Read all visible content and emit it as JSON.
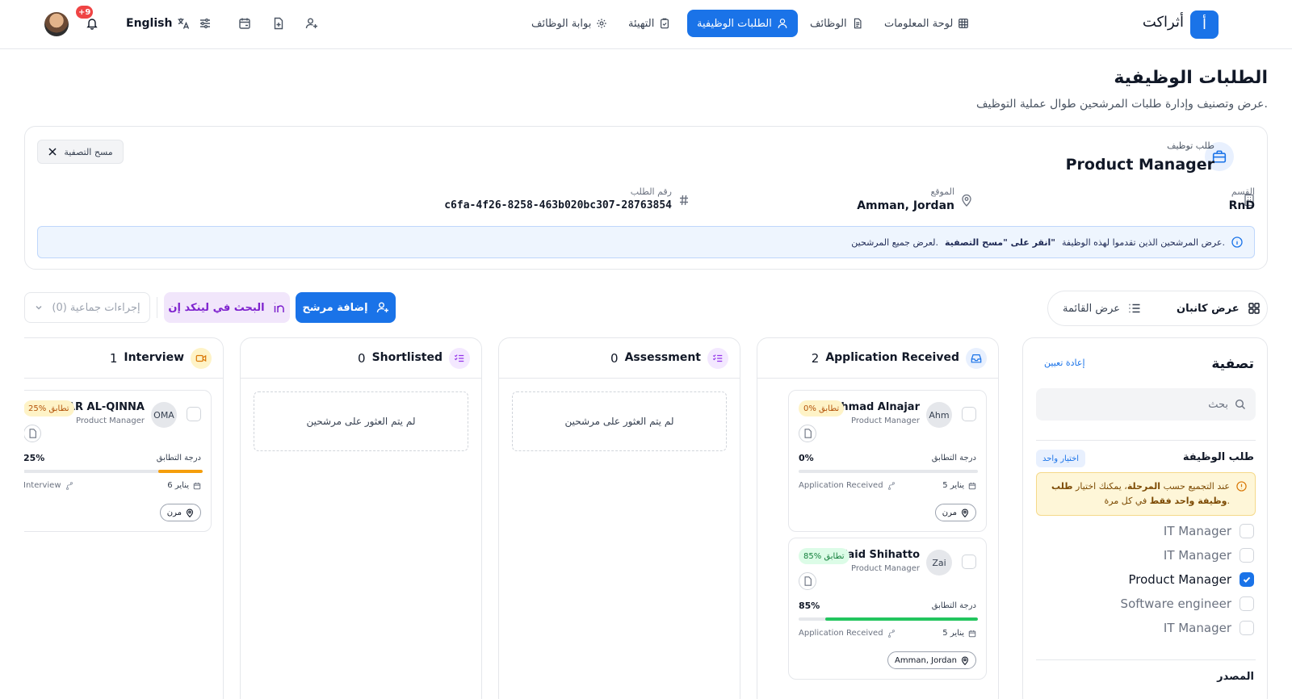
{
  "app": {
    "logo_letter": "أ",
    "name": "أثراكت"
  },
  "nav": [
    {
      "label": "لوحة المعلومات",
      "icon": "grid-icon"
    },
    {
      "label": "الوظائف",
      "icon": "document-icon"
    },
    {
      "label": "الطلبات الوظيفية",
      "icon": "user-icon",
      "active": true
    },
    {
      "label": "التهيئة",
      "icon": "clipboard-check-icon"
    },
    {
      "label": "بوابة الوظائف",
      "icon": "gear-icon"
    }
  ],
  "topbar": {
    "language": "English",
    "notifications_badge": "+9"
  },
  "page": {
    "title": "الطلبات الوظيفية",
    "subtitle": "عرض وتصنيف وإدارة طلبات المرشحين طوال عملية التوظيف."
  },
  "job": {
    "label": "طلب توظيف",
    "title": "Product Manager",
    "clear_filter": "مسح التصفية",
    "department_label": "القسم",
    "department": "RnD",
    "location_label": "الموقع",
    "location": "Amman, Jordan",
    "request_id_label": "رقم الطلب",
    "request_id": "c6fa-4f26-8258-463b020bc307-28763854",
    "banner_text": "عرض المرشحين الذين تقدموا لهذه الوظيفة.",
    "banner_bold": "انقر على \"مسح التصفية\"",
    "banner_tail": "لعرض جميع المرشحين."
  },
  "toolbar": {
    "kanban_view": "عرض كانبان",
    "list_view": "عرض القائمة",
    "add_candidate": "إضافة مرشح",
    "linkedin_search": "البحث في لينكد إن",
    "bulk_actions": "إجراءات جماعية (0)"
  },
  "filters": {
    "title": "تصفية",
    "reset": "إعادة تعيين",
    "search_placeholder": "بحث",
    "job_request_section": "طلب الوظيفة",
    "single_select": "اختيار واحد",
    "warning_pre": "عند التجميع حسب",
    "warning_b1": "المرحلة",
    "warning_mid": "، يمكنك اختيار",
    "warning_b2": "طلب وظيفة واحد فقط",
    "warning_post": "في كل مرة.",
    "options": [
      {
        "label": "IT Manager",
        "checked": false
      },
      {
        "label": "IT Manager",
        "checked": false
      },
      {
        "label": "Product Manager",
        "checked": true
      },
      {
        "label": "Software engineer",
        "checked": false
      },
      {
        "label": "IT Manager",
        "checked": false
      }
    ],
    "source_section": "المصدر"
  },
  "columns": [
    {
      "title": "Application Received",
      "count": "2",
      "icon": "inbox-icon",
      "color": "#1a73e8",
      "bg": "#e8f0fe"
    },
    {
      "title": "Assessment",
      "count": "0",
      "icon": "list-check-icon",
      "color": "#9333ea",
      "bg": "#f3e8ff",
      "empty": "لم يتم العثور على مرشحين"
    },
    {
      "title": "Shortlisted",
      "count": "0",
      "icon": "list-check-icon",
      "color": "#9333ea",
      "bg": "#f3e8ff",
      "empty": "لم يتم العثور على مرشحين"
    },
    {
      "title": "Interview",
      "count": "1",
      "icon": "video-icon",
      "color": "#d97706",
      "bg": "#fef3c7"
    }
  ],
  "cards": [
    {
      "initials": "Ahm",
      "name": "Ahmad Alnajar",
      "role": "Product Manager",
      "match_label": "0% تطابق",
      "match_color": "#b45309",
      "match_bg": "#fef3c7",
      "score_label": "درجة التطابق",
      "score": "0%",
      "score_fraction": 0,
      "bar_color": "#f59e0b",
      "date": "5 يناير",
      "stage": "Application Received",
      "location": "مرن"
    },
    {
      "initials": "Zai",
      "name": "Zaid Shihatto",
      "role": "Product Manager",
      "match_label": "85% تطابق",
      "match_color": "#15803d",
      "match_bg": "#dcfce7",
      "score_label": "درجة التطابق",
      "score": "85%",
      "score_fraction": 0.85,
      "bar_color": "#22c55e",
      "date": "5 يناير",
      "stage": "Application Received",
      "location": "Amman, Jordan"
    },
    {
      "initials": "OMA",
      "name": "OMAR AL-QINNA",
      "role": "Product Manager",
      "match_label": "25% تطابق",
      "match_color": "#b45309",
      "match_bg": "#fef3c7",
      "score_label": "درجة التطابق",
      "score": "25%",
      "score_fraction": 0.25,
      "bar_color": "#f59e0b",
      "date": "6 يناير",
      "stage": "Interview",
      "location": "مرن"
    }
  ]
}
